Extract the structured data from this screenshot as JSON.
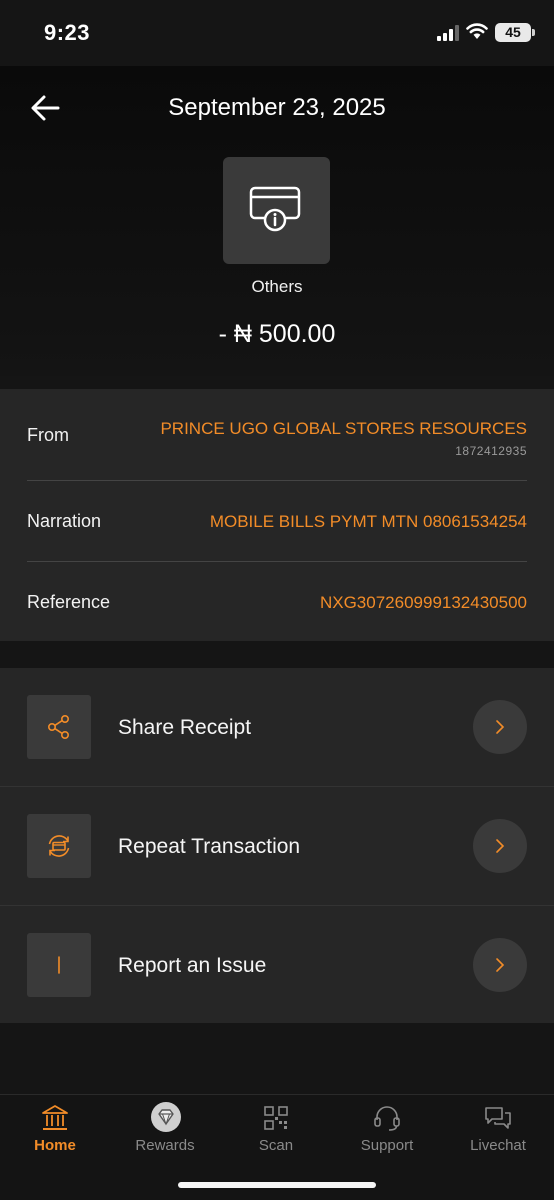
{
  "status_bar": {
    "time": "9:23",
    "battery": "45"
  },
  "header": {
    "title": "September 23, 2025",
    "category": "Others",
    "amount": "- ₦ 500.00"
  },
  "details": {
    "from_label": "From",
    "from_value": "PRINCE UGO GLOBAL STORES RESOURCES",
    "from_account": "1872412935",
    "narration_label": "Narration",
    "narration_value": "MOBILE BILLS PYMT MTN 08061534254",
    "reference_label": "Reference",
    "reference_value": "NXG307260999132430500"
  },
  "actions": [
    {
      "label": "Share Receipt",
      "icon": "share-icon"
    },
    {
      "label": "Repeat Transaction",
      "icon": "repeat-transaction-icon"
    },
    {
      "label": "Report an Issue",
      "icon": "report-issue-icon"
    }
  ],
  "nav": [
    {
      "label": "Home",
      "icon": "bank-icon",
      "active": true
    },
    {
      "label": "Rewards",
      "icon": "diamond-icon",
      "active": false
    },
    {
      "label": "Scan",
      "icon": "qr-scan-icon",
      "active": false
    },
    {
      "label": "Support",
      "icon": "headset-icon",
      "active": false
    },
    {
      "label": "Livechat",
      "icon": "chat-icon",
      "active": false
    }
  ],
  "colors": {
    "accent": "#f28c28",
    "background": "#151515",
    "card": "#262626"
  }
}
